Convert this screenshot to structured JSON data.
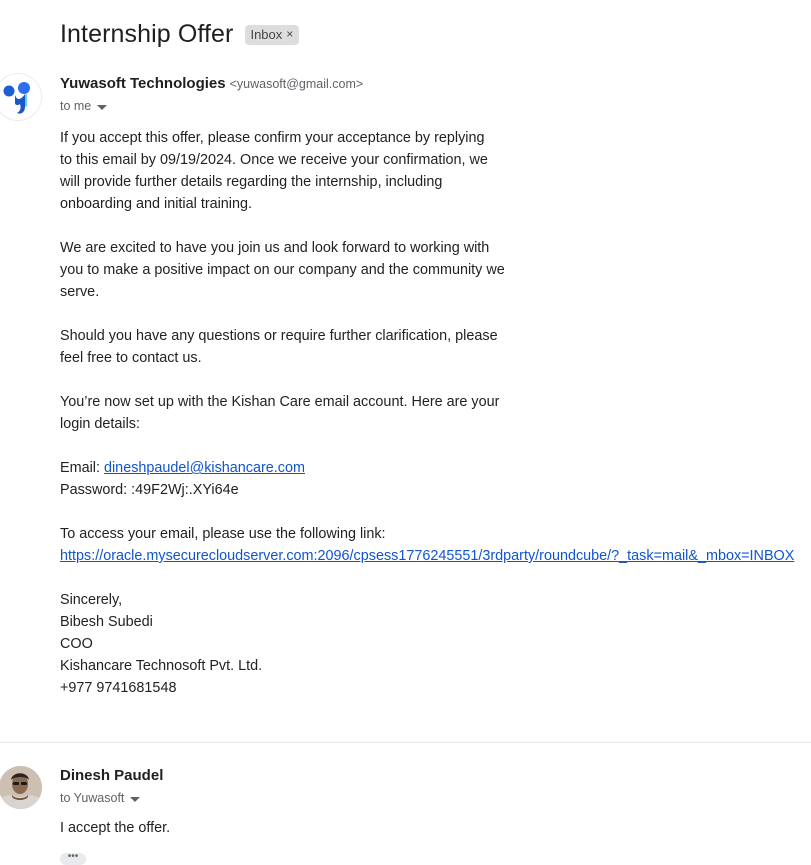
{
  "thread": {
    "subject": "Internship Offer",
    "label": "Inbox",
    "label_close": "×"
  },
  "message1": {
    "sender_name": "Yuwasoft Technologies",
    "sender_email": "<yuwasoft@gmail.com>",
    "to": "to me",
    "paragraphs": {
      "p1": [
        "If you accept this offer, please confirm your acceptance by replying",
        "to this email by 09/19/2024. Once we receive your confirmation, we",
        "will provide further details regarding the internship, including",
        "onboarding and initial training."
      ],
      "p2": [
        "We are excited to have you join us and look forward to working with",
        "you to make a positive impact on our company and the community we",
        "serve."
      ],
      "p3": [
        "Should you have any questions or require further clarification, please",
        "feel free to contact us."
      ],
      "p4": [
        "You’re now set up with the Kishan Care email account. Here are your",
        "login details:"
      ],
      "email_label": "Email: ",
      "email_value": "dineshpaudel@kishancare.com",
      "password_line": "Password: :49F2Wj:.XYi64e",
      "access_line": "To access your email, please use the following link:",
      "access_link": "https://oracle.mysecurecloudserver.com:2096/cpsess1776245551/3rdparty/roundcube/?_task=mail&_mbox=INBOX",
      "signature": [
        "Sincerely,",
        "Bibesh Subedi",
        "COO",
        "Kishancare Technosoft Pvt. Ltd.",
        "+977 9741681548"
      ]
    }
  },
  "message2": {
    "sender_name": "Dinesh Paudel",
    "to": "to Yuwasoft",
    "body": "I accept the offer.",
    "trimmed": "•••"
  },
  "colors": {
    "link": "#1155cc",
    "chip_bg": "#dddddd",
    "logo_blue": "#1a5fd6"
  },
  "icons": [
    "yuwasoft-logo-icon",
    "chevron-down-icon",
    "close-icon",
    "avatar-photo"
  ]
}
